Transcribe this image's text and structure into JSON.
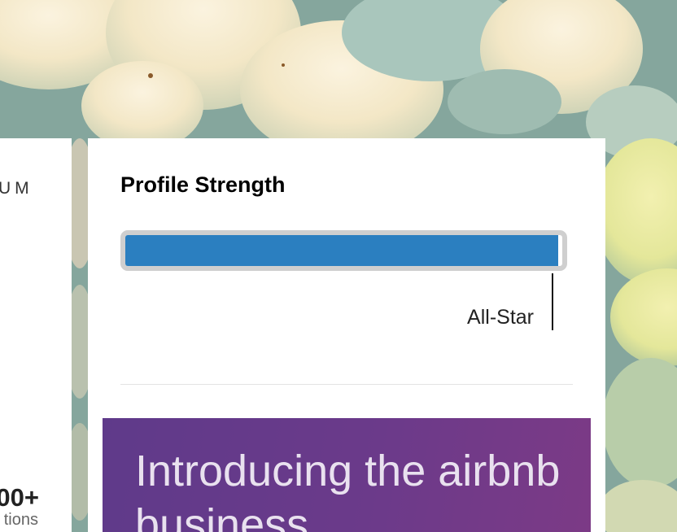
{
  "left_card": {
    "brand_fragment": "UM",
    "stat_number": "00+",
    "stat_label": "tions"
  },
  "profile_strength": {
    "title": "Profile Strength",
    "level_label": "All-Star",
    "level_fraction": 0.99,
    "bar_color": "#2b7fc0",
    "track_color": "#cfcfcf"
  },
  "ad": {
    "text": "Introducing the airbnb business",
    "background_color": "#6b3a8a"
  }
}
